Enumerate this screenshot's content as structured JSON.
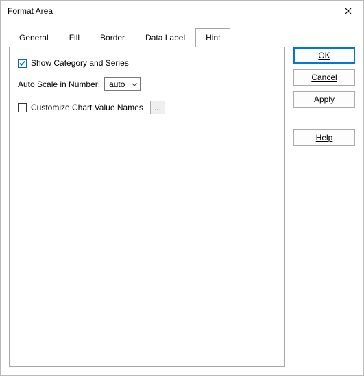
{
  "window": {
    "title": "Format Area"
  },
  "tabs": {
    "items": [
      {
        "label": "General"
      },
      {
        "label": "Fill"
      },
      {
        "label": "Border"
      },
      {
        "label": "Data Label"
      },
      {
        "label": "Hint"
      }
    ],
    "active": 4
  },
  "panel": {
    "show_category_series_label": "Show Category and Series",
    "show_category_series_checked": true,
    "auto_scale_label": "Auto Scale in Number:",
    "auto_scale_value": "auto",
    "customize_names_label": "Customize Chart Value Names",
    "customize_names_checked": false,
    "dots": "..."
  },
  "buttons": {
    "ok": "OK",
    "cancel": "Cancel",
    "apply": "Apply",
    "help": "Help"
  }
}
